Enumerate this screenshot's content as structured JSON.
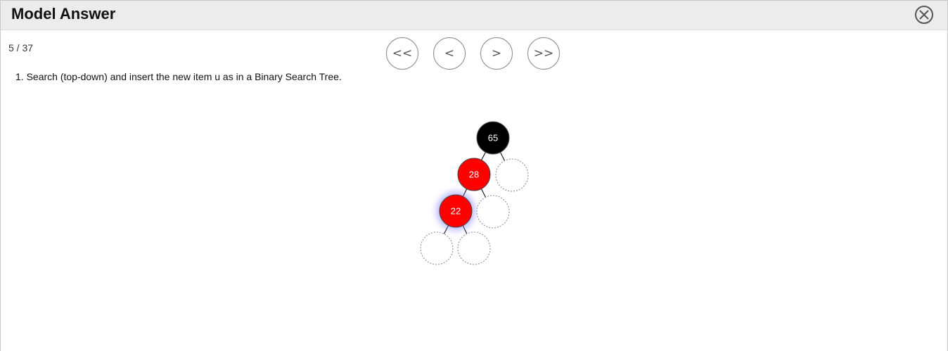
{
  "dialog": {
    "title": "Model Answer"
  },
  "navigation": {
    "counter": "5 / 37",
    "first_label": "<<",
    "prev_label": "<",
    "next_label": ">",
    "last_label": ">>"
  },
  "instructions": {
    "step_text": "1. Search (top-down) and insert the new item u as in a Binary Search Tree."
  },
  "tree": {
    "colors": {
      "black_node": "#000000",
      "red_node": "#ff0000",
      "highlight_glow": "#8080ff",
      "empty_node_border": "#888888"
    },
    "nodes": [
      {
        "id": "n65",
        "label": "65",
        "color": "black",
        "parent": null,
        "highlight": false
      },
      {
        "id": "n28",
        "label": "28",
        "color": "red",
        "parent": "n65",
        "highlight": false
      },
      {
        "id": "n65r",
        "label": "",
        "color": "empty",
        "parent": "n65",
        "highlight": false
      },
      {
        "id": "n22",
        "label": "22",
        "color": "red",
        "parent": "n28",
        "highlight": true
      },
      {
        "id": "n28r",
        "label": "",
        "color": "empty",
        "parent": "n28",
        "highlight": false
      },
      {
        "id": "n22l",
        "label": "",
        "color": "empty",
        "parent": "n22",
        "highlight": false
      },
      {
        "id": "n22r",
        "label": "",
        "color": "empty",
        "parent": "n22",
        "highlight": false
      }
    ]
  }
}
